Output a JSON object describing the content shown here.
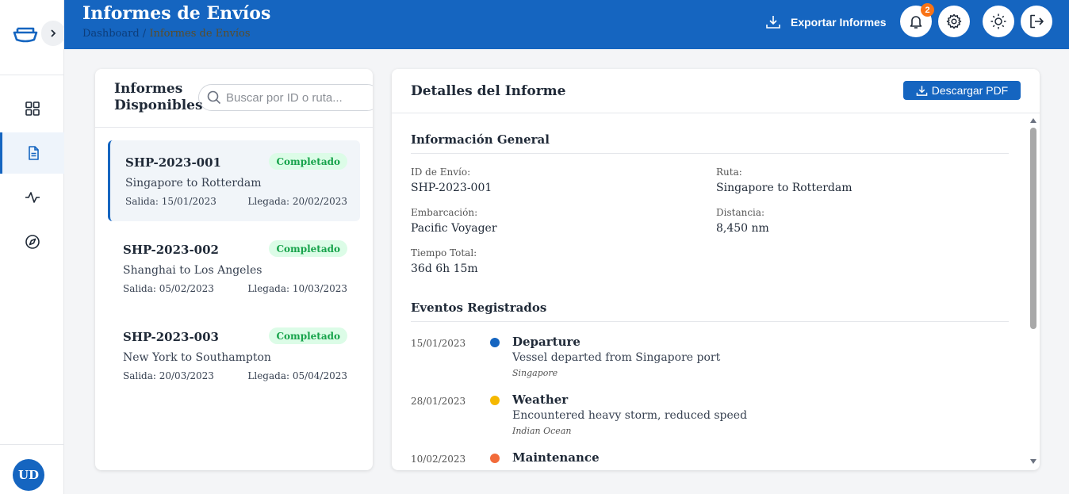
{
  "header": {
    "title": "Informes de Envíos",
    "breadcrumb_home": "Dashboard",
    "breadcrumb_sep": " / ",
    "breadcrumb_current": "Informes de Envíos",
    "export_label": "Exportar Informes",
    "notification_count": "2"
  },
  "sidebar": {
    "items": [
      {
        "icon": "dashboard-grid-icon"
      },
      {
        "icon": "document-icon",
        "active": true
      },
      {
        "icon": "activity-icon"
      },
      {
        "icon": "compass-icon"
      }
    ],
    "avatar": "UD"
  },
  "reports_panel": {
    "title": "Informes Disponibles",
    "search_placeholder": "Buscar por ID o ruta...",
    "items": [
      {
        "id": "SHP-2023-001",
        "status": "Completado",
        "route": "Singapore to Rotterdam",
        "departure": "Salida: 15/01/2023",
        "arrival": "Llegada: 20/02/2023"
      },
      {
        "id": "SHP-2023-002",
        "status": "Completado",
        "route": "Shanghai to Los Angeles",
        "departure": "Salida: 05/02/2023",
        "arrival": "Llegada: 10/03/2023"
      },
      {
        "id": "SHP-2023-003",
        "status": "Completado",
        "route": "New York to Southampton",
        "departure": "Salida: 20/03/2023",
        "arrival": "Llegada: 05/04/2023"
      }
    ]
  },
  "details": {
    "title": "Detalles del Informe",
    "download_label": "Descargar PDF",
    "general_title": "Información General",
    "fields": {
      "shipment_id_label": "ID de Envío:",
      "shipment_id": "SHP-2023-001",
      "route_label": "Ruta:",
      "route": "Singapore to Rotterdam",
      "vessel_label": "Embarcación:",
      "vessel": "Pacific Voyager",
      "distance_label": "Distancia:",
      "distance": "8,450 nm",
      "total_time_label": "Tiempo Total:",
      "total_time": "36d 6h 15m"
    },
    "events_title": "Eventos Registrados",
    "events": [
      {
        "date": "15/01/2023",
        "type": "Departure",
        "description": "Vessel departed from Singapore port",
        "location": "Singapore",
        "color": "#1565c0"
      },
      {
        "date": "28/01/2023",
        "type": "Weather",
        "description": "Encountered heavy storm, reduced speed",
        "location": "Indian Ocean",
        "color": "#f5b800"
      },
      {
        "date": "10/02/2023",
        "type": "Maintenance",
        "description": "",
        "location": "",
        "color": "#f26b3a"
      }
    ]
  },
  "colors": {
    "primary": "#1565c0",
    "success_bg": "#dcfce7",
    "success_text": "#16a34a",
    "badge": "#f97316"
  }
}
